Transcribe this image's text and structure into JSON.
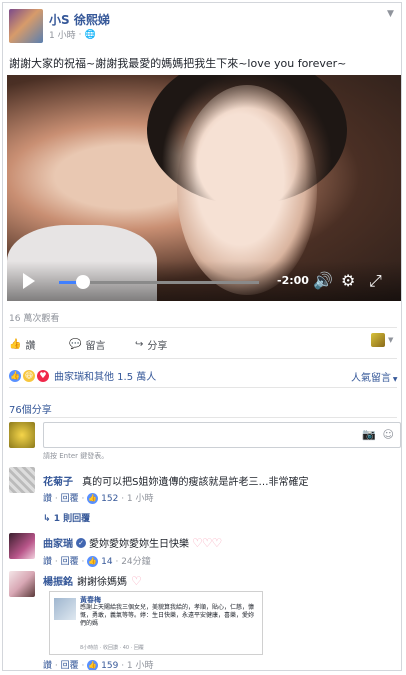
{
  "post": {
    "author": "小S 徐熙娣",
    "time": "1 小時",
    "privacy_icon": "globe-icon",
    "text": "謝謝大家的祝福~謝謝我最愛的媽媽把我生下來~love you forever~"
  },
  "video": {
    "progress": 0.12,
    "time_remaining": "-2:00",
    "views": "16 萬次觀看"
  },
  "actions": {
    "like": "讚",
    "comment": "留言",
    "share": "分享"
  },
  "reactions": {
    "summary": "曲家瑞和其他 1.5 萬人",
    "sort": "人氣留言"
  },
  "shares": "76個分享",
  "comment_box": {
    "hint": "請按 Enter 鍵發表。"
  },
  "comments": [
    {
      "name": "花菊子",
      "text": "真的可以把S姐妳遺傳的瘦該就是許老三…非常確定",
      "like": "讚",
      "reply": "回覆",
      "likes": "152",
      "time": "1 小時",
      "replies": "1 則回覆"
    },
    {
      "name": "曲家瑞",
      "text": "愛妳愛妳愛妳生日快樂",
      "like": "讚",
      "reply": "回覆",
      "likes": "14",
      "time": "24分鐘"
    },
    {
      "name": "楊振銘",
      "text": "謝謝徐媽媽",
      "like": "讚",
      "reply": "回覆",
      "likes": "159",
      "time": "1 小時"
    }
  ],
  "embed": {
    "name": "黃春梅",
    "text": "感謝上天賜給我三個女兒，美貌算我給的，孝順，貼心，仁慈，慷慨，勇敢，義氣等等。婷：生日快樂，永遠平安健康，喜樂，愛妳們的媽",
    "meta": "8小時前 · 收回讚 · 40 · 回覆"
  },
  "colors": {
    "link": "#365899",
    "like_blue": "#5890ff",
    "heart_pink": "#f5a0b5"
  }
}
